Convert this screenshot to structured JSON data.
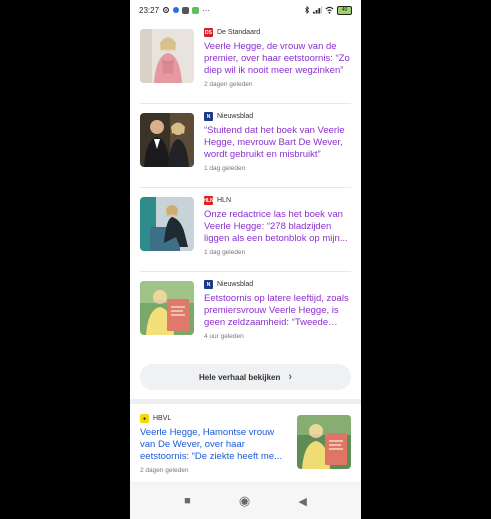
{
  "status_bar": {
    "time": "23:27",
    "icons": [
      "settings-icon",
      "chat-bubble-icon",
      "g-icon",
      "s-icon",
      "more-icon"
    ],
    "right_icons": [
      "bluetooth-icon",
      "signal-icon",
      "wifi-icon",
      "battery-icon"
    ],
    "more": "···",
    "battery": "40"
  },
  "articles": [
    {
      "source": "De Standaard",
      "source_logo": "DS",
      "logo_color": "#d4202a",
      "headline": "Veerle Hegge, de vrouw van de premier, over haar eetstoornis: “Zo diep wil ik nooit meer wegzinken”",
      "time": "2 dagen geleden",
      "thumb": "woman-portrait-image"
    },
    {
      "source": "Nieuwsblad",
      "source_logo": "N",
      "logo_color": "#1d3a8a",
      "headline": "“Stuitend dat het boek van Veerle Hegge, mevrouw Bart De Wever, wordt gebruikt en misbruikt”",
      "time": "1 dag geleden",
      "thumb": "couple-photo-image"
    },
    {
      "source": "HLN",
      "source_logo": "HLN",
      "logo_color": "#e2231a",
      "headline": "Onze redactrice las het boek van Veerle Hegge: “278 bladzijden liggen als een betonblok op mijn...",
      "time": "1 dag geleden",
      "thumb": "woman-seated-image"
    },
    {
      "source": "Nieuwsblad",
      "source_logo": "N",
      "logo_color": "#1d3a8a",
      "headline": "Eetstoornis op latere leeftijd, zoals premiersvrouw Veerle Hegge, is geen zeldzaamheid: “Tweede pie...",
      "time": "4 uur geleden",
      "thumb": "woman-with-book-image"
    }
  ],
  "more_button": {
    "label": "Hele verhaal bekijken",
    "arrow": "›"
  },
  "story": {
    "source": "HBVL",
    "source_logo": "●",
    "logo_color": "#f5d800",
    "headline": "Veerle Hegge, Hamontse vrouw van De Wever, over haar eetstoornis: “De ziekte heeft me...",
    "time": "2 dagen geleden",
    "thumb": "woman-with-book-image"
  },
  "navbar": {
    "back": "◀",
    "home": "◉",
    "recents": "■"
  }
}
